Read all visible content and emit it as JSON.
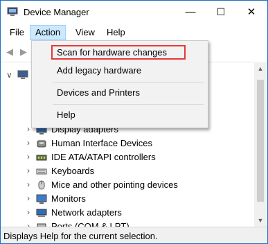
{
  "window": {
    "title": "Device Manager",
    "controls": [
      "—",
      "☐",
      "✕"
    ]
  },
  "menubar": {
    "items": [
      "File",
      "Action",
      "View",
      "Help"
    ],
    "active": "Action"
  },
  "dropdown": {
    "items": [
      "Scan for hardware changes",
      "Add legacy hardware",
      "Devices and Printers",
      "Help"
    ],
    "highlighted": "Scan for hardware changes",
    "highlight_color": "#e53935"
  },
  "tree": {
    "items": [
      {
        "label": "Display adapters",
        "icon": "display-adapter-icon"
      },
      {
        "label": "Human Interface Devices",
        "icon": "hid-icon"
      },
      {
        "label": "IDE ATA/ATAPI controllers",
        "icon": "ide-controller-icon"
      },
      {
        "label": "Keyboards",
        "icon": "keyboard-icon"
      },
      {
        "label": "Mice and other pointing devices",
        "icon": "mouse-icon"
      },
      {
        "label": "Monitors",
        "icon": "monitor-icon"
      },
      {
        "label": "Network adapters",
        "icon": "network-adapter-icon"
      },
      {
        "label": "Ports (COM & LPT)",
        "icon": "port-icon"
      }
    ]
  },
  "statusbar": {
    "text": "Displays Help for the current selection."
  }
}
